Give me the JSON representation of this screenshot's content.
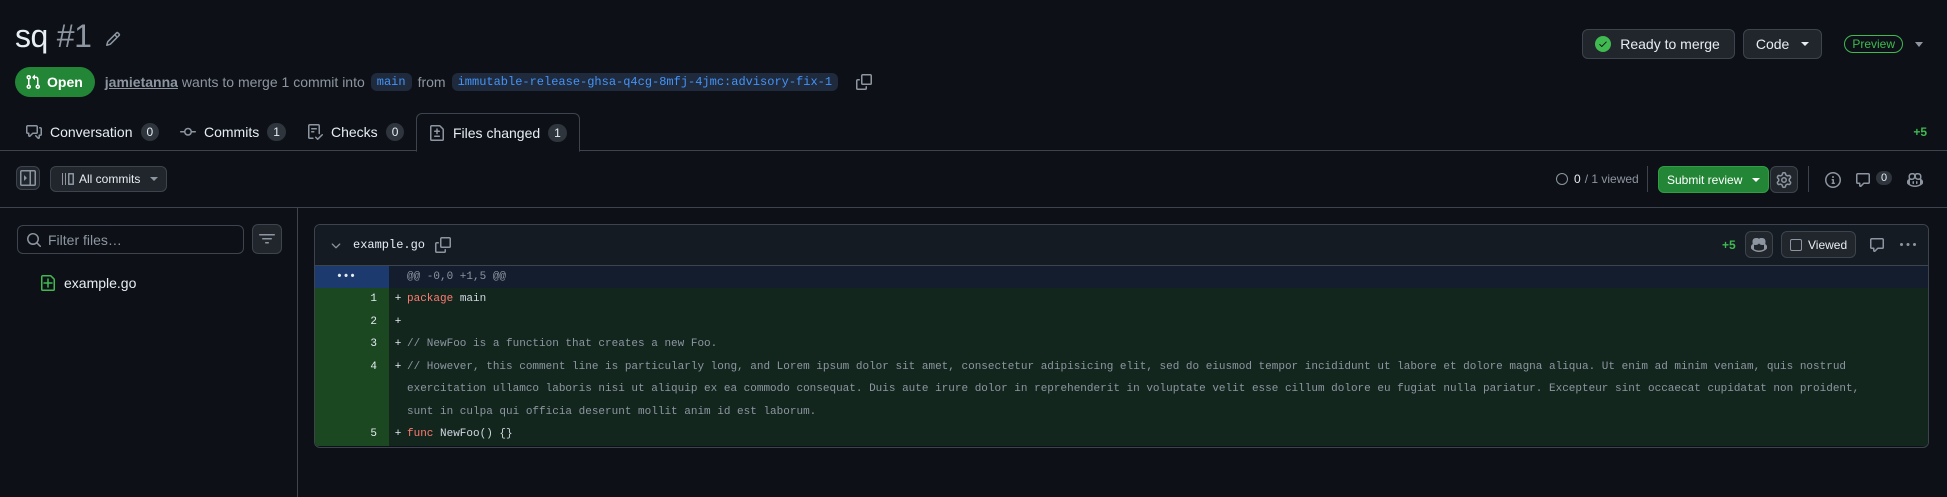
{
  "header": {
    "title": "sq",
    "number": "#1",
    "merge_status": "Ready to merge",
    "code_label": "Code",
    "preview_label": "Preview"
  },
  "meta": {
    "state": "Open",
    "author": "jamietanna",
    "text_before": "wants to merge 1 commit into",
    "base_branch": "main",
    "text_from": "from",
    "head_branch": "immutable-release-ghsa-q4cg-8mfj-4jmc:advisory-fix-1"
  },
  "tabs": [
    {
      "label": "Conversation",
      "count": "0"
    },
    {
      "label": "Commits",
      "count": "1"
    },
    {
      "label": "Checks",
      "count": "0"
    },
    {
      "label": "Files changed",
      "count": "1"
    }
  ],
  "tabs_additions": "+5",
  "toolbar": {
    "all_commits": "All commits",
    "viewed_done": "0",
    "viewed_total": "/ 1 viewed",
    "submit_review": "Submit review",
    "comments_count": "0"
  },
  "sidebar": {
    "filter_placeholder": "Filter files…",
    "files": [
      "example.go"
    ]
  },
  "diff": {
    "filename": "example.go",
    "additions": "+5",
    "viewed_label": "Viewed",
    "hunk_header": "@@ -0,0 +1,5 @@",
    "lines": [
      {
        "num": "1",
        "marker": "+",
        "keyword": "package",
        "rest": " main"
      },
      {
        "num": "2",
        "marker": "+",
        "text": ""
      },
      {
        "num": "3",
        "marker": "+",
        "comment": "// NewFoo is a function that creates a new Foo."
      },
      {
        "num": "4",
        "marker": "+",
        "comment": "// However, this comment line is particularly long, and Lorem ipsum dolor sit amet, consectetur adipisicing elit, sed do eiusmod tempor incididunt ut labore et dolore magna aliqua. Ut enim ad minim veniam, quis nostrud exercitation ullamco laboris nisi ut aliquip ex ea commodo consequat. Duis aute irure dolor in reprehenderit in voluptate velit esse cillum dolore eu fugiat nulla pariatur. Excepteur sint occaecat cupidatat non proident, sunt in culpa qui officia deserunt mollit anim id est laborum."
      },
      {
        "num": "5",
        "marker": "+",
        "keyword": "func",
        "rest": " NewFoo() {}"
      }
    ]
  },
  "colors": {
    "accent_green": "#238636",
    "addition_bg": "#12261e",
    "line_number_bg": "#1b4721",
    "link_blue": "#4493f8"
  },
  "icons": [
    "pencil-icon",
    "check-circle-icon",
    "git-pull-request-icon",
    "copy-icon",
    "comment-discussion-icon",
    "git-commit-icon",
    "checklist-icon",
    "file-diff-icon",
    "sidebar-expand-icon",
    "commits-icon",
    "gear-icon",
    "info-icon",
    "comment-icon",
    "copilot-icon",
    "search-icon",
    "filter-icon",
    "file-added-icon",
    "chevron-down-icon",
    "kebab-horizontal-icon"
  ]
}
